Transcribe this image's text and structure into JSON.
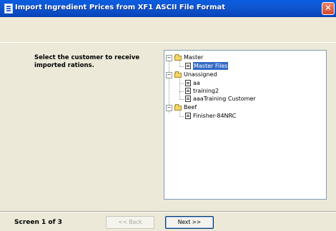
{
  "window": {
    "title": "Import Ingredient Prices from XF1 ASCII File Format",
    "close_symbol": "✕"
  },
  "prompt": "Select the customer to receive imported rations.",
  "tree": {
    "groups": [
      {
        "label": "Master",
        "toggle": "−",
        "items": [
          "Master Files"
        ]
      },
      {
        "label": "Unassigned",
        "toggle": "−",
        "items": [
          "aa",
          "training2",
          "aaaTraining Customer"
        ]
      },
      {
        "label": "Beef",
        "toggle": "−",
        "items": [
          "Finisher-84NRC"
        ]
      }
    ],
    "selected": "Master Files"
  },
  "footer": {
    "screen_indicator": "Screen 1 of 3",
    "back_label": "<< Back",
    "next_label": "Next >>"
  }
}
